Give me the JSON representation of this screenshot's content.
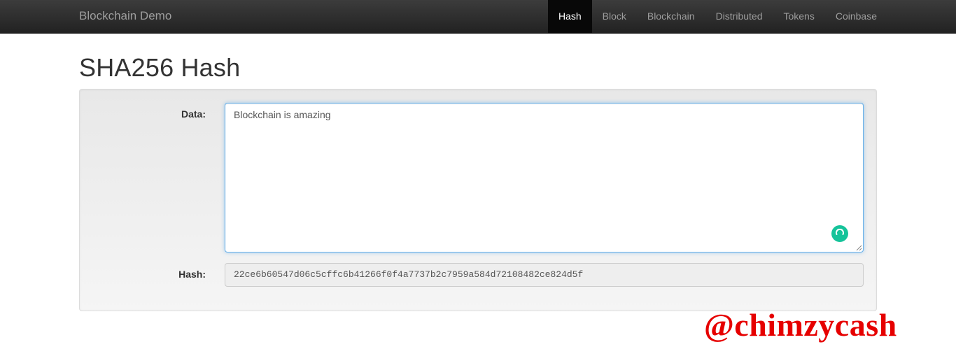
{
  "navbar": {
    "brand": "Blockchain Demo",
    "items": [
      {
        "label": "Hash",
        "active": true
      },
      {
        "label": "Block",
        "active": false
      },
      {
        "label": "Blockchain",
        "active": false
      },
      {
        "label": "Distributed",
        "active": false
      },
      {
        "label": "Tokens",
        "active": false
      },
      {
        "label": "Coinbase",
        "active": false
      }
    ]
  },
  "page": {
    "title": "SHA256 Hash"
  },
  "form": {
    "data_label": "Data:",
    "data_value": "Blockchain is amazing",
    "hash_label": "Hash:",
    "hash_value": "22ce6b60547d06c5cffc6b41266f0f4a7737b2c7959a584d72108482ce824d5f"
  },
  "watermark": {
    "text": "@chimzycash"
  },
  "colors": {
    "navbar_bg": "#222222",
    "active_nav_bg": "#080808",
    "focus_border": "#66afe9",
    "grammarly": "#15c39a",
    "watermark": "#e60000"
  }
}
